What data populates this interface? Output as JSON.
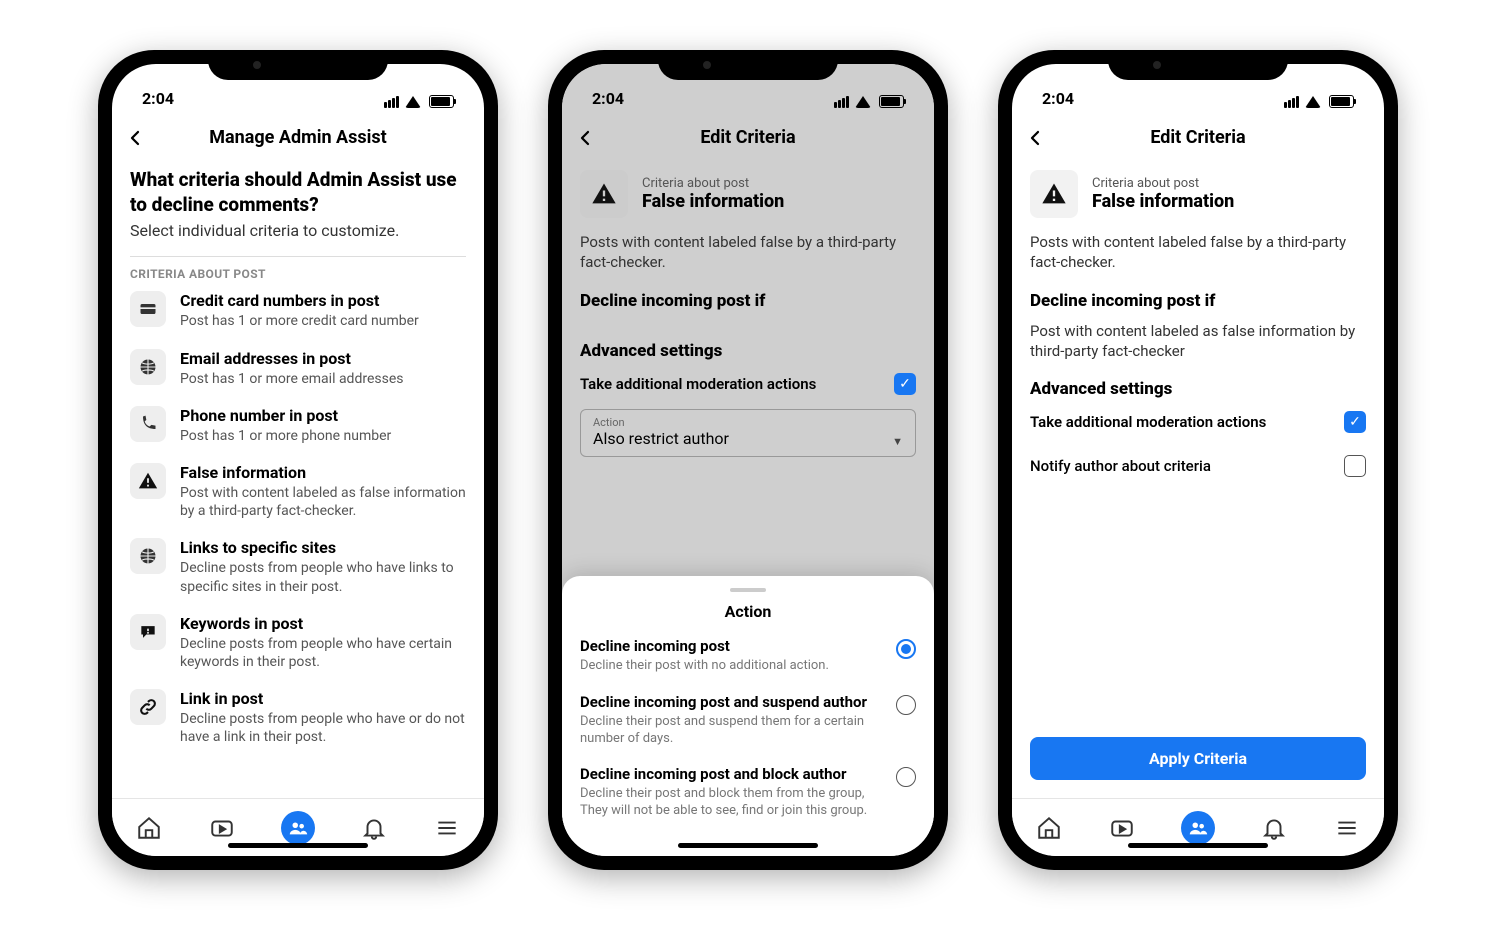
{
  "status": {
    "time": "2:04"
  },
  "phone1": {
    "headerTitle": "Manage Admin Assist",
    "question": "What criteria should Admin Assist use to decline comments?",
    "subtext": "Select individual criteria to customize.",
    "sectionLabel": "CRITERIA ABOUT POST",
    "items": [
      {
        "title": "Credit card numbers in post",
        "desc": "Post has 1 or more credit card number"
      },
      {
        "title": "Email addresses in post",
        "desc": "Post has 1 or more email addresses"
      },
      {
        "title": "Phone number in post",
        "desc": "Post has 1 or more phone number"
      },
      {
        "title": "False information",
        "desc": "Post with content labeled as false information by a third-party fact-checker."
      },
      {
        "title": "Links to specific sites",
        "desc": "Decline posts from people who have links to specific sites in their post."
      },
      {
        "title": "Keywords in post",
        "desc": "Decline posts from people who have certain keywords in their post."
      },
      {
        "title": "Link in post",
        "desc": "Decline posts from people who have or do not have a link in their post."
      }
    ]
  },
  "phone2": {
    "headerTitle": "Edit Criteria",
    "eyebrow": "Criteria about post",
    "critTitle": "False information",
    "body": "Posts with content labeled false by a third-party fact-checker.",
    "subhead1": "Decline incoming post if",
    "advanced": "Advanced settings",
    "setting1": "Take additional moderation actions",
    "dropdownLabel": "Action",
    "dropdownValue": "Also restrict author",
    "sheetTitle": "Action",
    "options": [
      {
        "title": "Decline incoming post",
        "desc": "Decline their post with no additional action.",
        "selected": true
      },
      {
        "title": "Decline incoming post and suspend author",
        "desc": "Decline their post and suspend them for a certain number of days.",
        "selected": false
      },
      {
        "title": "Decline incoming post and block author",
        "desc": "Decline their post and block them from the group, They will not be able to see, find or join this group.",
        "selected": false
      }
    ]
  },
  "phone3": {
    "headerTitle": "Edit Criteria",
    "eyebrow": "Criteria about post",
    "critTitle": "False information",
    "body": "Posts with content labeled false by a third-party fact-checker.",
    "subhead1": "Decline incoming post if",
    "ruleText": "Post with content labeled as false information by third-party fact-checker",
    "advanced": "Advanced settings",
    "setting1": "Take additional moderation actions",
    "setting2": "Notify author about criteria",
    "applyLabel": "Apply Criteria"
  }
}
